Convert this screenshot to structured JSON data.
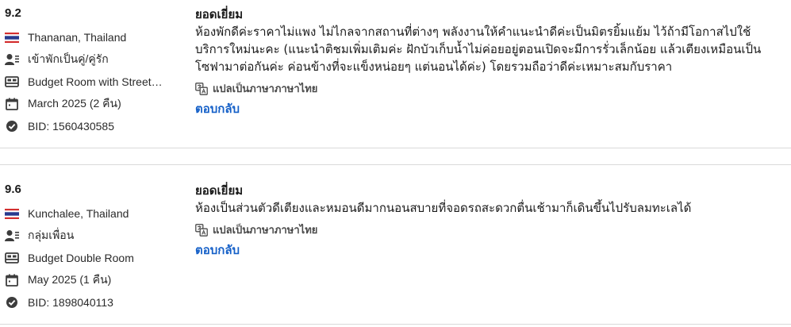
{
  "reviews": [
    {
      "score": "9.2",
      "reviewer": "Thananan, Thailand",
      "traveler_type": "เข้าพักเป็นคู่/คู่รัก",
      "room": "Budget Room with Street…",
      "stay": "March 2025 (2 คืน)",
      "bid": "BID: 1560430585",
      "title": "ยอดเยี่ยม",
      "body": "ห้องพักดีค่ะราคาไม่แพง ไม่ไกลจากสถานที่ต่างๆ พลังงานให้คำแนะนำดีค่ะเป็นมิตรยิ้มแย้ม ไว้ถ้ามีโอกาสไปใช้บริการใหม่นะคะ (แนะนำติชมเพิ่มเติมค่ะ ฝักบัวเก็บน้ำไม่ค่อยอยู่ตอนเปิดจะมีการรั่วเล็กน้อย แล้วเตียงเหมือนเป็นโซฟามาต่อกันค่ะ ค่อนข้างที่จะแข็งหน่อยๆ แต่นอนได้ค่ะ) โดยรวมถือว่าดีค่ะเหมาะสมกับราคา",
      "translate": "แปลเป็นภาษาภาษาไทย",
      "reply": "ตอบกลับ"
    },
    {
      "score": "9.6",
      "reviewer": "Kunchalee, Thailand",
      "traveler_type": "กลุ่มเพื่อน",
      "room": "Budget Double Room",
      "stay": "May 2025 (1 คืน)",
      "bid": "BID: 1898040113",
      "title": "ยอดเยี่ยม",
      "body": "ห้องเป็นส่วนตัวดีเตียงและหมอนดีมากนอนสบายที่จอดรถสะดวกตื่นเช้ามาก็เดินขึ้นไปรับลมทะเลได้",
      "translate": "แปลเป็นภาษาภาษาไทย",
      "reply": "ตอบกลับ"
    }
  ],
  "icons": {
    "flag": "thailand-flag-icon",
    "traveler": "traveler-type-icon",
    "room": "bed-icon",
    "stay": "calendar-icon",
    "bid": "check-circle-icon",
    "translate": "translate-icon"
  },
  "colors": {
    "reply": "#1560c8",
    "icon": "#3d3d3d",
    "divider": "#dadada",
    "flag_red": "#d32f2f",
    "flag_blue": "#283a8e"
  }
}
